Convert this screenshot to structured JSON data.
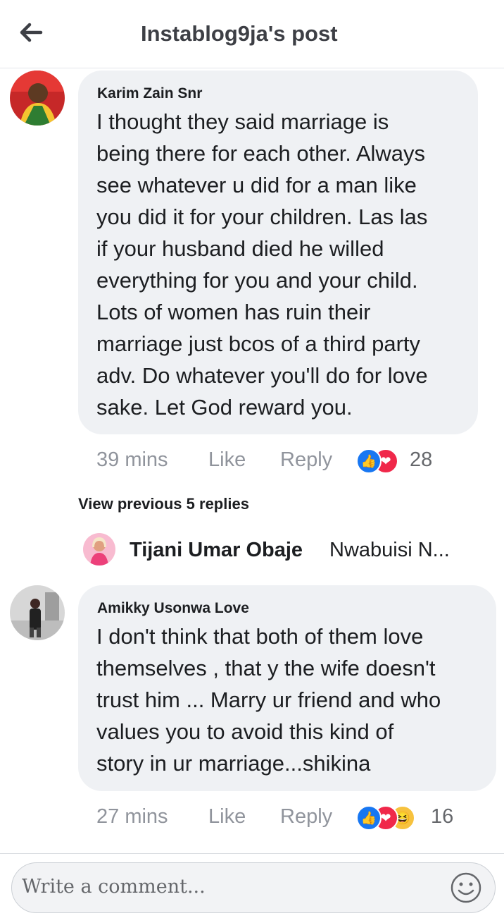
{
  "header": {
    "title": "Instablog9ja's post",
    "back_icon": "back-arrow-icon"
  },
  "comments": [
    {
      "author": "Karim Zain Snr",
      "text_lines": [
        "I thought they said marriage is",
        "being there for each other. Always",
        "see whatever u did for a man like",
        "you did it for your children. Las las",
        "if your husband died he willed",
        "everything for you and your child.",
        "Lots of women has ruin their",
        "marriage just bcos of a third party",
        "adv. Do whatever you'll do for love",
        "sake. Let God reward you."
      ],
      "time": "39 mins",
      "like_label": "Like",
      "reply_label": "Reply",
      "reactions": [
        "like",
        "love"
      ],
      "reaction_count": "28"
    },
    {
      "author": "Amikky Usonwa Love",
      "text_lines": [
        "I don't think that both of them love",
        "themselves , that y the wife doesn't",
        "trust him ... Marry ur friend and who",
        "values you to avoid this kind of",
        "story in ur marriage...shikina"
      ],
      "time": "27 mins",
      "like_label": "Like",
      "reply_label": "Reply",
      "reactions": [
        "like",
        "love",
        "haha"
      ],
      "reaction_count": "16"
    }
  ],
  "view_previous": "View previous 5 replies",
  "reply_preview": {
    "name": "Tijani Umar Obaje",
    "snippet": "Nwabuisi N..."
  },
  "composer": {
    "placeholder": "Write a comment...",
    "emoji_icon": "smiley-icon"
  },
  "colors": {
    "bubble": "#eff1f4",
    "like": "#1877f2",
    "love": "#f0284a",
    "meta": "#90949c"
  }
}
